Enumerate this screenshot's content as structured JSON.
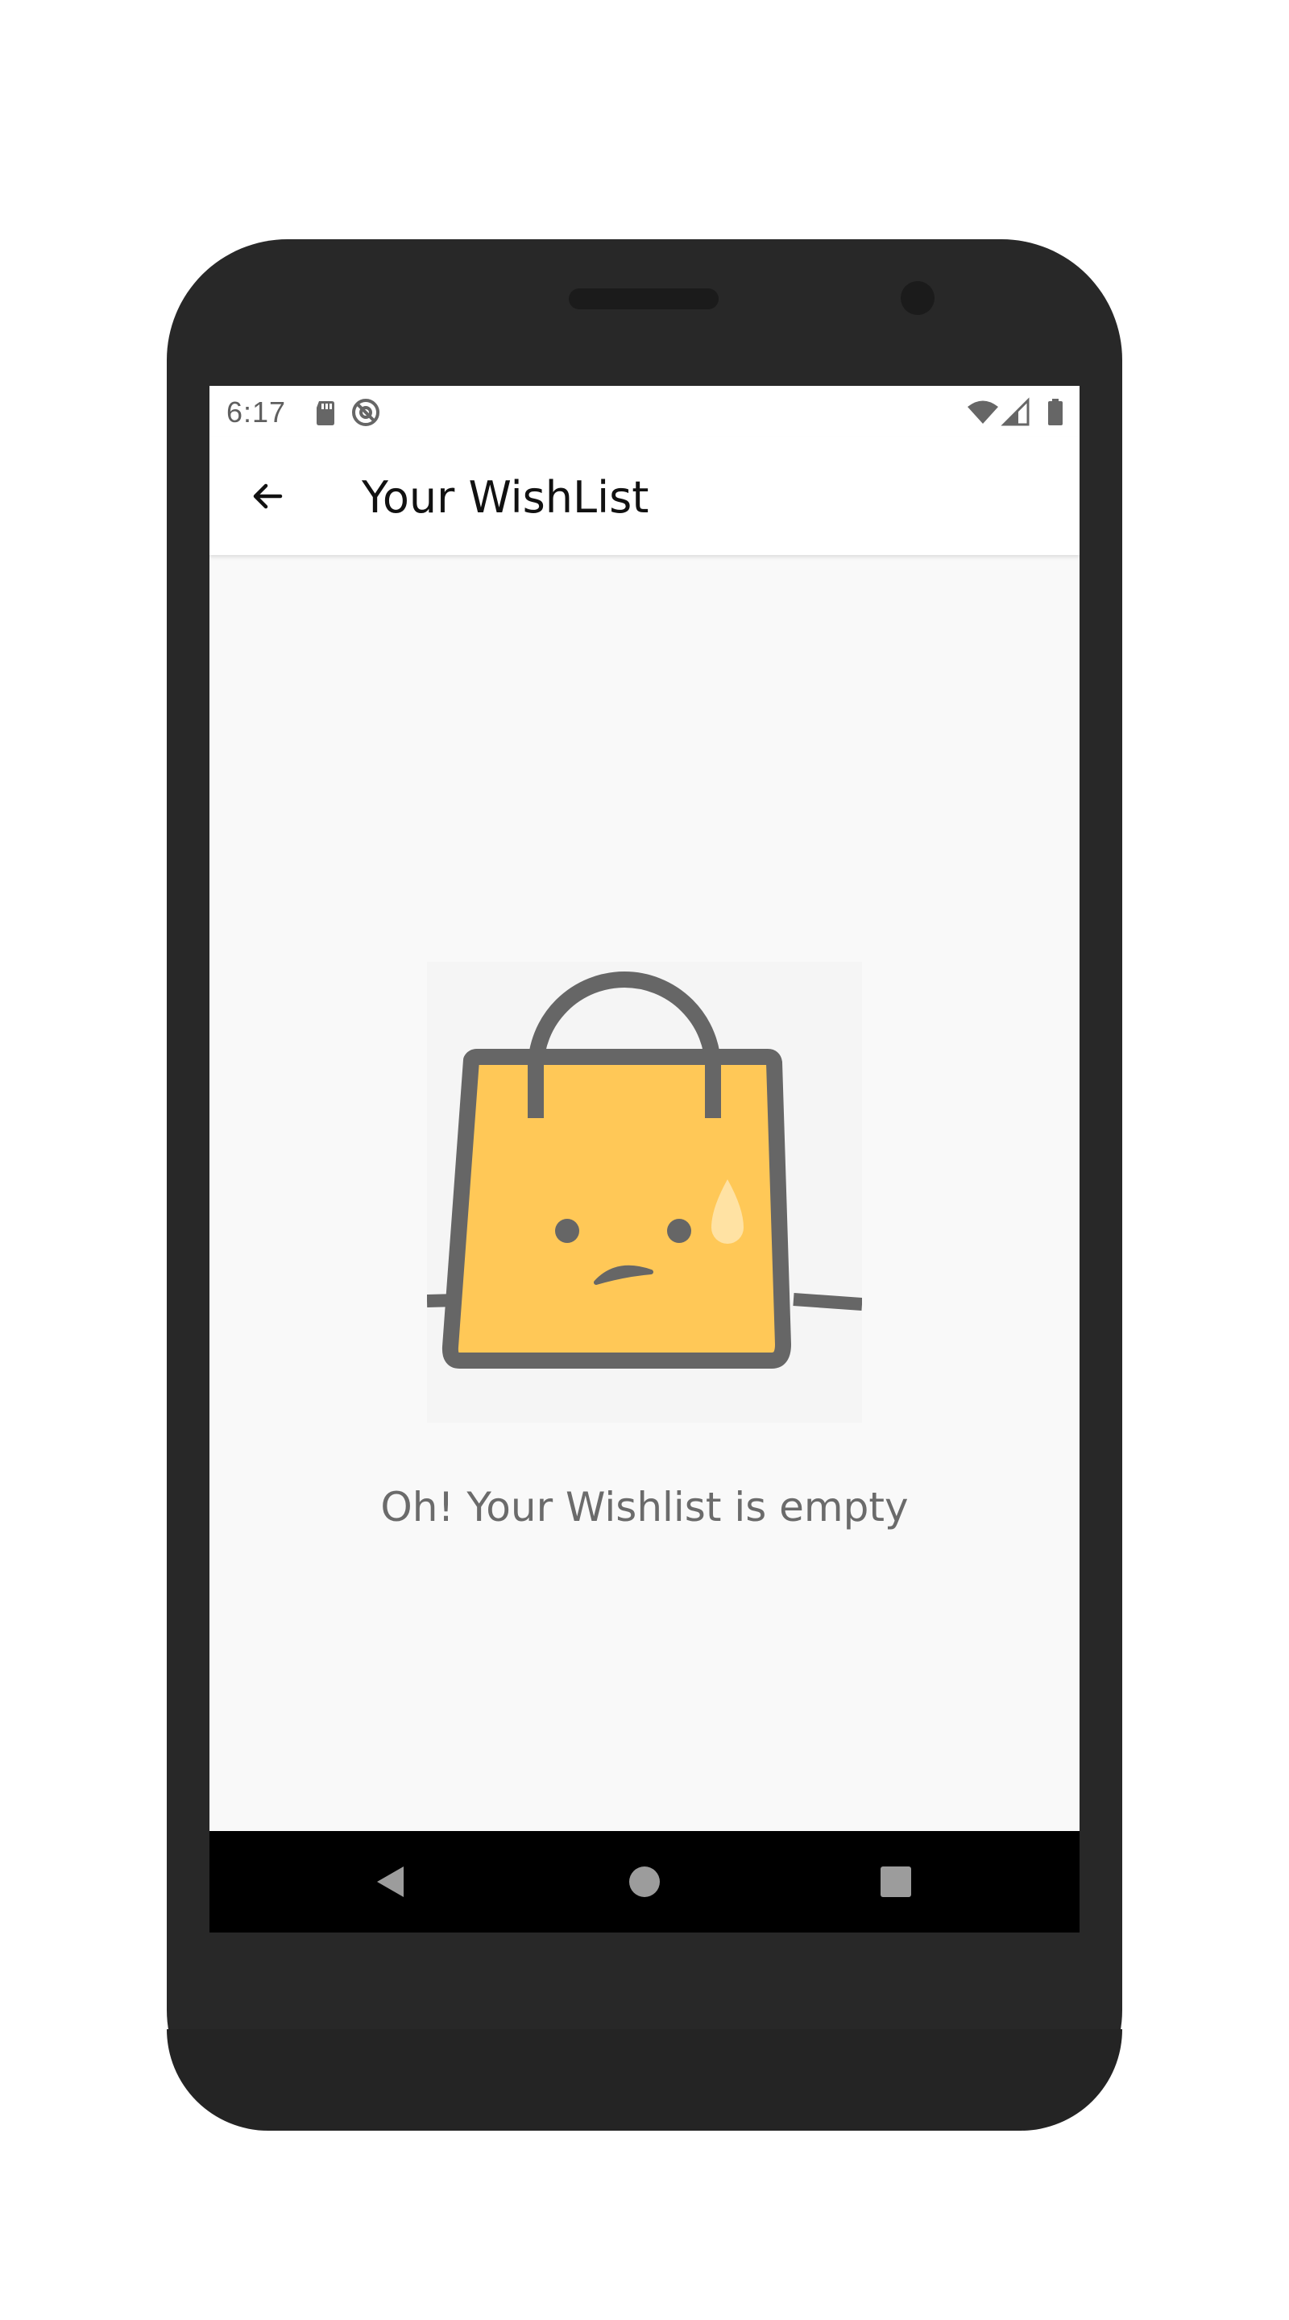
{
  "status_bar": {
    "time": "6:17",
    "left_icons": [
      "sd-card-icon",
      "sync-disabled-icon"
    ],
    "right_icons": [
      "wifi-icon",
      "cell-signal-icon",
      "battery-icon"
    ]
  },
  "app_bar": {
    "back_icon": "arrow-left-icon",
    "title": "Your WishList"
  },
  "empty_state": {
    "illustration": "sad-shopping-bag",
    "message": "Oh! Your Wishlist is empty",
    "colors": {
      "bag_fill": "#FFC857",
      "outline": "#666666",
      "tear": "#FFE2A3"
    }
  },
  "nav_bar": {
    "buttons": [
      "back-triangle-icon",
      "home-circle-icon",
      "recents-square-icon"
    ]
  },
  "colors": {
    "device_body": "#282828",
    "screen_bg": "#F9F9F9",
    "app_bar_bg": "#FFFFFF",
    "nav_bar_bg": "#000000"
  }
}
